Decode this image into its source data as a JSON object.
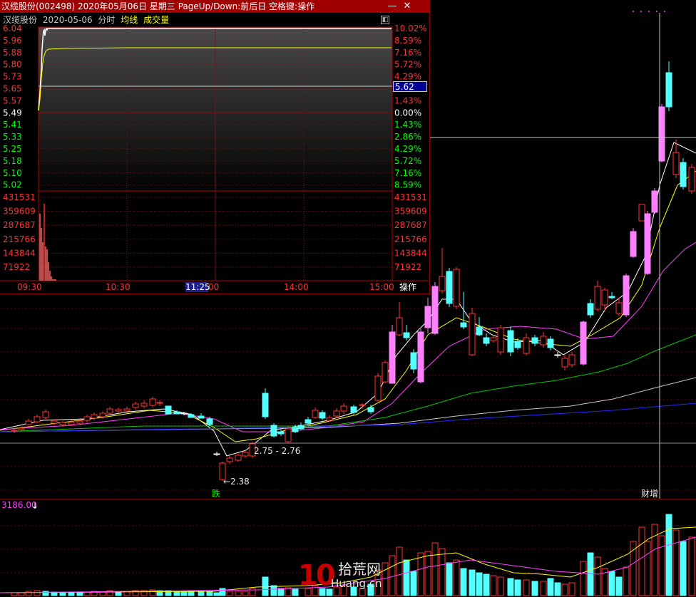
{
  "popup": {
    "title": "汉缆股份(002498) 2020年05月06日 星期三 PageUp/Down:前后日 空格键:操作",
    "minimize_glyph": "—",
    "close_glyph": "✕",
    "stock_name": "汉缆股份",
    "date": "2020-05-06",
    "mode": "分时",
    "avg_line_label": "均线",
    "volume_label": "成交量",
    "price_labels": [
      "6.04",
      "5.96",
      "5.88",
      "5.80",
      "5.73",
      "5.65",
      "5.57",
      "5.49",
      "5.41",
      "5.33",
      "5.25",
      "5.18",
      "5.10",
      "5.02"
    ],
    "pct_labels": [
      "10.02%",
      "8.59%",
      "7.16%",
      "5.72%",
      "4.29%",
      "2.86%",
      "1.43%",
      "0.00%",
      "1.43%",
      "2.86%",
      "4.29%",
      "5.72%",
      "7.16%",
      "8.59%"
    ],
    "vol_labels": [
      "431531",
      "359609",
      "287687",
      "215766",
      "143844",
      "71922"
    ],
    "time_labels": [
      "09:30",
      "10:30",
      "14:00",
      "15:00"
    ],
    "time_partial": "00",
    "cursor_price": "5.62",
    "cursor_time": "11:25",
    "ops_label": "操作"
  },
  "kline": {
    "annotation_range": "2.75 - 2.76",
    "low_label": "2.38",
    "marker_fall": "跌",
    "marker_report": "财增"
  },
  "volume_panel": {
    "value_label": "3186.00",
    "arrow": "↓"
  },
  "watermark": {
    "brand_digits": "10",
    "brand_cn": "拾荒网",
    "brand_url": "Huang.cn"
  },
  "colors": {
    "up": "#ff3232",
    "down": "#54ffff",
    "limit_up": "#ff80ff",
    "ma5": "#ffffff",
    "ma10": "#ffff00",
    "ma20": "#ff40ff",
    "ma60": "#00c800",
    "ma120": "#c8c8c8",
    "ma250": "#2828ff"
  }
}
